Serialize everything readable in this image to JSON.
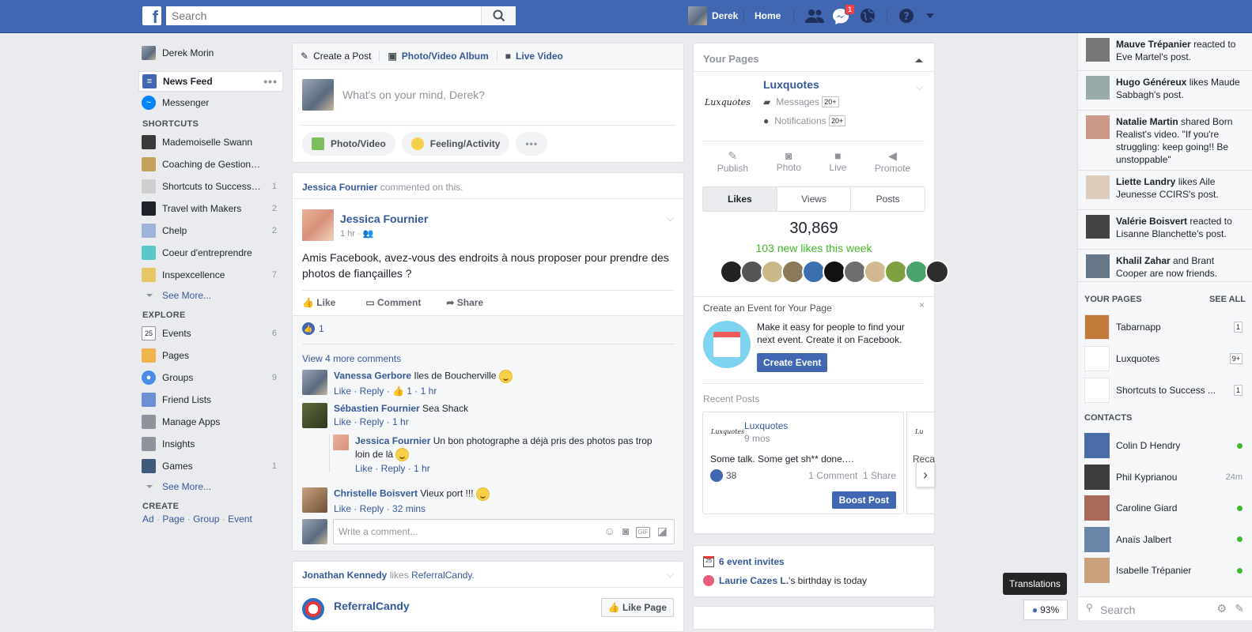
{
  "topbar": {
    "logo": "f",
    "search_placeholder": "Search",
    "user": "Derek",
    "home": "Home",
    "messages_badge": "1"
  },
  "left_nav": {
    "profile": "Derek Morin",
    "news_feed": "News Feed",
    "messenger": "Messenger",
    "shortcuts_header": "SHORTCUTS",
    "shortcuts": [
      {
        "label": "Mademoiselle Swann",
        "count": ""
      },
      {
        "label": "Coaching de Gestion…",
        "count": ""
      },
      {
        "label": "Shortcuts to Success…",
        "count": "1"
      },
      {
        "label": "Travel with Makers",
        "count": "2"
      },
      {
        "label": "Chelp",
        "count": "2"
      },
      {
        "label": "Coeur d'entreprendre",
        "count": ""
      },
      {
        "label": "Inspexcellence",
        "count": "7"
      }
    ],
    "see_more": "See More...",
    "explore_header": "EXPLORE",
    "explore": [
      {
        "label": "Events",
        "count": "6"
      },
      {
        "label": "Pages",
        "count": ""
      },
      {
        "label": "Groups",
        "count": "9"
      },
      {
        "label": "Friend Lists",
        "count": ""
      },
      {
        "label": "Manage Apps",
        "count": ""
      },
      {
        "label": "Insights",
        "count": ""
      },
      {
        "label": "Games",
        "count": "1"
      }
    ],
    "create_header": "CREATE",
    "create_links": [
      "Ad",
      "Page",
      "Group",
      "Event"
    ]
  },
  "composer": {
    "tabs": [
      "Create a Post",
      "Photo/Video Album",
      "Live Video"
    ],
    "placeholder": "What's on your mind, Derek?",
    "actions": [
      "Photo/Video",
      "Feeling/Activity"
    ]
  },
  "post": {
    "context_name": "Jessica Fournier",
    "context_text": "commented on this.",
    "author": "Jessica Fournier",
    "time": "1 hr ·",
    "body": "Amis Facebook, avez-vous des endroits à nous proposer pour prendre des photos de fiançailles ?",
    "actions": [
      "Like",
      "Comment",
      "Share"
    ],
    "likes": "1",
    "view_more": "View 4 more comments",
    "comments": [
      {
        "name": "Vanessa Gerbore",
        "text": "Iles de Boucherville",
        "meta": "Like · Reply · 👍 1 · 1 hr"
      },
      {
        "name": "Sébastien Fournier",
        "text": "Sea Shack",
        "meta": "Like · Reply · 1 hr"
      },
      {
        "name": "Jessica Fournier",
        "text": "Un bon photographe a déjà pris des photos pas trop loin de là",
        "meta": "Like · Reply · 1 hr"
      },
      {
        "name": "Christelle Boisvert",
        "text": "Vieux port !!!",
        "meta": "Like · Reply · 32 mins"
      }
    ],
    "write_placeholder": "Write a comment..."
  },
  "post2": {
    "actor": "Jonathan Kennedy",
    "verb": "likes",
    "object": "ReferralCandy.",
    "page": "ReferralCandy",
    "like_page": "Like Page"
  },
  "your_pages": {
    "title": "Your Pages",
    "page_name": "Luxquotes",
    "logo_text": "Luxquotes",
    "messages": "Messages",
    "messages_count": "20+",
    "notifications": "Notifications",
    "notifications_count": "20+",
    "actions": [
      "Publish",
      "Photo",
      "Live",
      "Promote"
    ],
    "tabs": [
      "Likes",
      "Views",
      "Posts"
    ],
    "likes_total": "30,869",
    "likes_week": "103 new likes this week",
    "event_title": "Create an Event for Your Page",
    "event_text": "Make it easy for people to find your next event. Create it on Facebook.",
    "event_button": "Create Event",
    "recent_title": "Recent Posts",
    "recent_name": "Luxquotes",
    "recent_time": "9 mos",
    "recent_text": "Some talk. Some get sh** done.…",
    "recent_likes": "38",
    "recent_comments": "1 Comment",
    "recent_shares": "1 Share",
    "boost": "Boost Post",
    "next_peek": "Reca"
  },
  "events_box": {
    "invites": "6 event invites",
    "birthday_name": "Laurie Cazes L.",
    "birthday_text": "'s birthday is today"
  },
  "ticker": [
    {
      "name": "Mauve Trépanier",
      "text": "reacted to Eve Martel's post."
    },
    {
      "name": "Hugo Généreux",
      "text": "likes Maude Sabbagh's post."
    },
    {
      "name": "Natalie Martin",
      "text": "shared Born Realist's video. \"If you're struggling: keep going!! Be unstoppable\""
    },
    {
      "name": "Liette Landry",
      "text": "likes Aile Jeunesse CCIRS's post."
    },
    {
      "name": "Valérie Boisvert",
      "text": "reacted to Lisanne Blanchette's post."
    },
    {
      "name": "Khalil Zahar",
      "text": "and Brant Cooper are now friends."
    }
  ],
  "sidebar_pages": {
    "header": "YOUR PAGES",
    "see_all": "SEE ALL",
    "items": [
      {
        "name": "Tabarnapp",
        "count": "1"
      },
      {
        "name": "Luxquotes",
        "count": "9+"
      },
      {
        "name": "Shortcuts to Success ...",
        "count": "1"
      }
    ]
  },
  "contacts": {
    "header": "CONTACTS",
    "items": [
      {
        "name": "Colin D Hendry",
        "status": ""
      },
      {
        "name": "Phil Kyprianou",
        "status": "24m"
      },
      {
        "name": "Caroline Giard",
        "status": ""
      },
      {
        "name": "Anaïs Jalbert",
        "status": ""
      },
      {
        "name": "Isabelle Trépanier",
        "status": ""
      }
    ],
    "search_placeholder": "Search"
  },
  "tooltip": "Translations",
  "translation_pct": "93%",
  "colors": {
    "brand": "#4267b2",
    "link": "#365899",
    "online": "#42b72a",
    "green_text": "#42b72a"
  }
}
